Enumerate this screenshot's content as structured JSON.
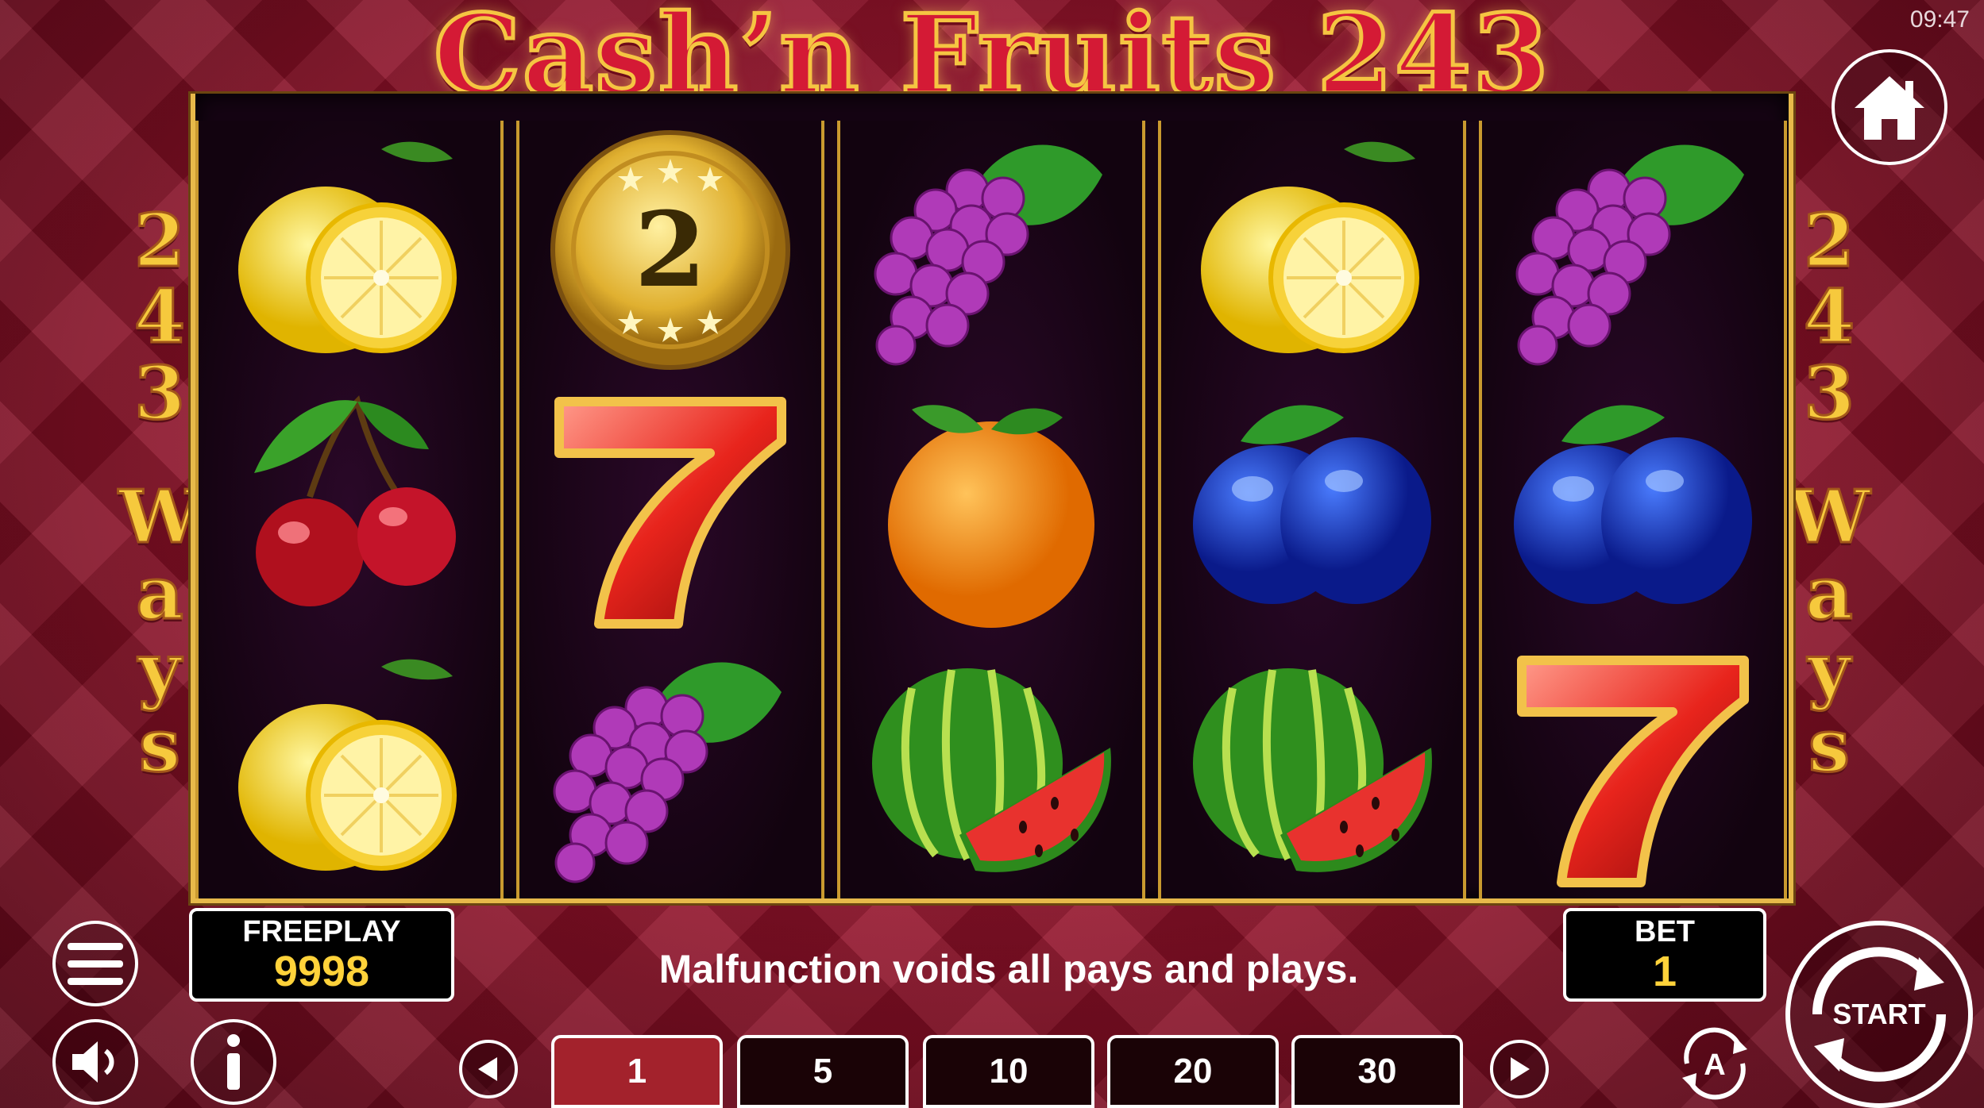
{
  "status": {
    "time": "09:47"
  },
  "game": {
    "title": "Cash’n Fruits 243"
  },
  "side_label": {
    "number": [
      "2",
      "4",
      "3"
    ],
    "word": [
      "W",
      "a",
      "y",
      "s"
    ]
  },
  "reels": [
    [
      "lemon",
      "cherries",
      "lemon"
    ],
    [
      "coin",
      "seven",
      "grapes"
    ],
    [
      "grapes",
      "orange",
      "watermelon"
    ],
    [
      "lemon",
      "plum",
      "watermelon"
    ],
    [
      "grapes",
      "plum",
      "seven"
    ]
  ],
  "coin": {
    "value": "2"
  },
  "freeplay": {
    "label": "FREEPLAY",
    "value": "9998"
  },
  "bet": {
    "label": "BET",
    "value": "1"
  },
  "message": "Malfunction voids all pays and plays.",
  "bet_options": [
    "1",
    "5",
    "10",
    "20",
    "30"
  ],
  "selected_bet": "1",
  "buttons": {
    "start": "START",
    "auto": "A"
  },
  "icons": [
    "home-icon",
    "menu-icon",
    "sound-icon",
    "info-icon",
    "prev-arrow-icon",
    "next-arrow-icon",
    "autoplay-icon",
    "start-spin-icon"
  ],
  "colors": {
    "frame_gold": "#e7b94a",
    "background_red": "#8e1128",
    "active_bet": "#a3222c"
  }
}
